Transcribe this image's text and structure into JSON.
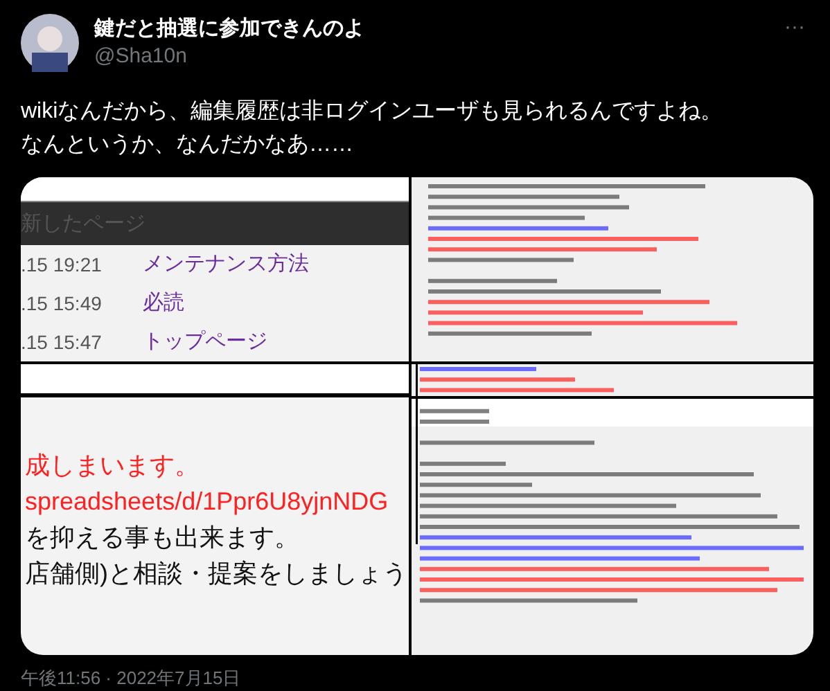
{
  "author": {
    "name": "鍵だと抽選に参加できんのよ",
    "handle": "@Sha10n"
  },
  "more": "···",
  "text_lines": [
    "wikiなんだから、編集履歴は非ログインユーザも見られるんですよね。",
    "なんというか、なんだかなあ……"
  ],
  "images": [
    {
      "kind": "recent_pages",
      "header": "新したページ",
      "rows": [
        {
          "time": ".15 19:21",
          "link": "メンテナンス方法"
        },
        {
          "time": ".15 15:49",
          "link": "必読"
        },
        {
          "time": ".15 15:47",
          "link": "トップページ"
        }
      ]
    },
    {
      "kind": "thumbnail"
    },
    {
      "kind": "wiki_text",
      "lines": [
        {
          "text": "成しまいます。",
          "color": "#ff2020"
        },
        {
          "text": "spreadsheets/d/1Ppr6U8yjnNDG",
          "color": "#ff2020"
        },
        {
          "text": "を抑える事も出来ます。",
          "color": "#111111"
        },
        {
          "text": "店舗側)と相談・提案をしましょう",
          "color": "#111111"
        }
      ]
    },
    {
      "kind": "thumbnail_split"
    }
  ],
  "timestamp": "午後11:56 · 2022年7月15日"
}
